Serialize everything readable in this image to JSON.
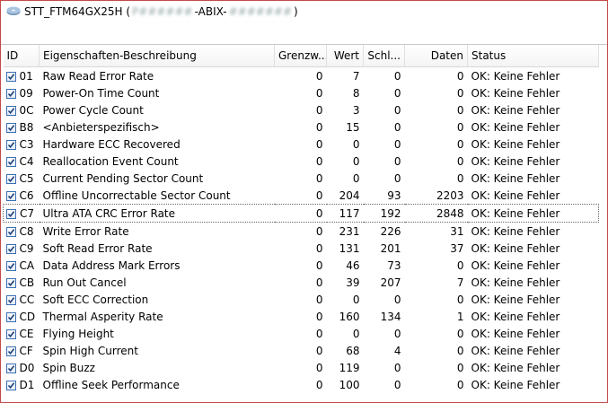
{
  "window": {
    "title_prefix": "STT_FTM64GX25H (",
    "title_blur1": "P######",
    "title_mid": "-ABIX-",
    "title_blur2": "#######",
    "title_suffix": ")"
  },
  "columns": {
    "id": "ID",
    "desc": "Eigenschaften-Beschreibung",
    "threshold": "Grenzw...",
    "value": "Wert",
    "worst": "Schl...",
    "data": "Daten",
    "status": "Status"
  },
  "rows": [
    {
      "id": "01",
      "desc": "Raw Read Error Rate",
      "threshold": "0",
      "value": "7",
      "worst": "0",
      "data": "0",
      "status": "OK: Keine Fehler"
    },
    {
      "id": "09",
      "desc": "Power-On Time Count",
      "threshold": "0",
      "value": "8",
      "worst": "0",
      "data": "0",
      "status": "OK: Keine Fehler"
    },
    {
      "id": "0C",
      "desc": "Power Cycle Count",
      "threshold": "0",
      "value": "3",
      "worst": "0",
      "data": "0",
      "status": "OK: Keine Fehler"
    },
    {
      "id": "B8",
      "desc": "<Anbieterspezifisch>",
      "threshold": "0",
      "value": "15",
      "worst": "0",
      "data": "0",
      "status": "OK: Keine Fehler"
    },
    {
      "id": "C3",
      "desc": "Hardware ECC Recovered",
      "threshold": "0",
      "value": "0",
      "worst": "0",
      "data": "0",
      "status": "OK: Keine Fehler"
    },
    {
      "id": "C4",
      "desc": "Reallocation Event Count",
      "threshold": "0",
      "value": "0",
      "worst": "0",
      "data": "0",
      "status": "OK: Keine Fehler"
    },
    {
      "id": "C5",
      "desc": "Current Pending Sector Count",
      "threshold": "0",
      "value": "0",
      "worst": "0",
      "data": "0",
      "status": "OK: Keine Fehler"
    },
    {
      "id": "C6",
      "desc": "Offline Uncorrectable Sector Count",
      "threshold": "0",
      "value": "204",
      "worst": "93",
      "data": "2203",
      "status": "OK: Keine Fehler"
    },
    {
      "id": "C7",
      "desc": "Ultra ATA CRC Error Rate",
      "threshold": "0",
      "value": "117",
      "worst": "192",
      "data": "2848",
      "status": "OK: Keine Fehler",
      "selected": true
    },
    {
      "id": "C8",
      "desc": "Write Error Rate",
      "threshold": "0",
      "value": "231",
      "worst": "226",
      "data": "31",
      "status": "OK: Keine Fehler"
    },
    {
      "id": "C9",
      "desc": "Soft Read Error Rate",
      "threshold": "0",
      "value": "131",
      "worst": "201",
      "data": "37",
      "status": "OK: Keine Fehler"
    },
    {
      "id": "CA",
      "desc": "Data Address Mark Errors",
      "threshold": "0",
      "value": "46",
      "worst": "73",
      "data": "0",
      "status": "OK: Keine Fehler"
    },
    {
      "id": "CB",
      "desc": "Run Out Cancel",
      "threshold": "0",
      "value": "39",
      "worst": "207",
      "data": "7",
      "status": "OK: Keine Fehler"
    },
    {
      "id": "CC",
      "desc": "Soft ECC Correction",
      "threshold": "0",
      "value": "0",
      "worst": "0",
      "data": "0",
      "status": "OK: Keine Fehler"
    },
    {
      "id": "CD",
      "desc": "Thermal Asperity Rate",
      "threshold": "0",
      "value": "160",
      "worst": "134",
      "data": "1",
      "status": "OK: Keine Fehler"
    },
    {
      "id": "CE",
      "desc": "Flying Height",
      "threshold": "0",
      "value": "0",
      "worst": "0",
      "data": "0",
      "status": "OK: Keine Fehler"
    },
    {
      "id": "CF",
      "desc": "Spin High Current",
      "threshold": "0",
      "value": "68",
      "worst": "4",
      "data": "0",
      "status": "OK: Keine Fehler"
    },
    {
      "id": "D0",
      "desc": "Spin Buzz",
      "threshold": "0",
      "value": "119",
      "worst": "0",
      "data": "0",
      "status": "OK: Keine Fehler"
    },
    {
      "id": "D1",
      "desc": "Offline Seek Performance",
      "threshold": "0",
      "value": "100",
      "worst": "0",
      "data": "0",
      "status": "OK: Keine Fehler"
    }
  ],
  "icons": {
    "drive": "drive-icon",
    "checkbox": "checkbox-checked-icon"
  }
}
